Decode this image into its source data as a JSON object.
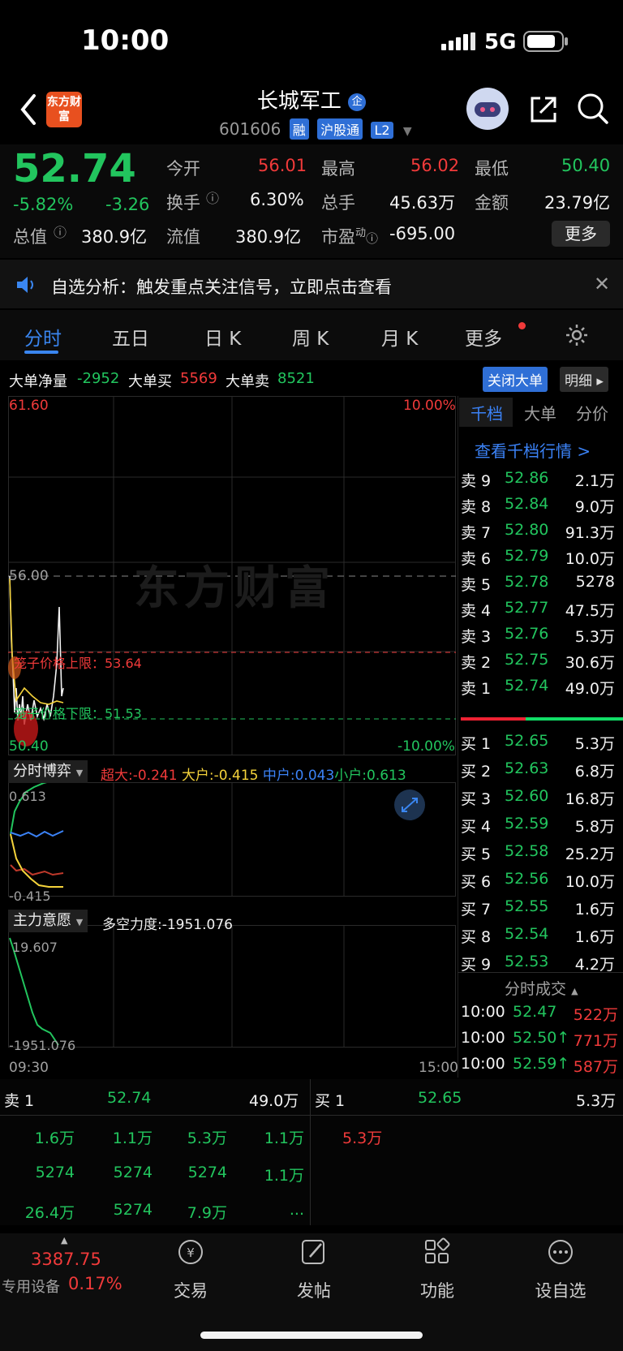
{
  "status": {
    "time": "10:00",
    "network": "5G"
  },
  "header": {
    "back": "‹",
    "logo_text": "东方财富",
    "title": "长城军工",
    "title_badge": "企",
    "code": "601606",
    "tags": [
      "融",
      "沪股通",
      "L2"
    ]
  },
  "quote": {
    "price": "52.74",
    "change_pct": "-5.82%",
    "change": "-3.26",
    "open_label": "今开",
    "open": "56.01",
    "high_label": "最高",
    "high": "56.02",
    "low_label": "最低",
    "low": "50.40",
    "turnover_label": "换手",
    "turnover": "6.30%",
    "volume_label": "总手",
    "volume": "45.63万",
    "amount_label": "金额",
    "amount": "23.79亿",
    "mcap_label": "总值",
    "mcap": "380.9亿",
    "float_label": "流值",
    "float": "380.9亿",
    "pe_label": "市盈",
    "pe_sup": "动",
    "pe": "-695.00",
    "more_label": "更多"
  },
  "notice": {
    "text": "自选分析：触发重点关注信号，立即点击查看"
  },
  "tabs": [
    "分时",
    "五日",
    "日 K",
    "周 K",
    "月 K",
    "更多"
  ],
  "bigorder": {
    "net_label": "大单净量",
    "net": "-2952",
    "buy_label": "大单买",
    "buy": "5569",
    "sell_label": "大单卖",
    "sell": "8521",
    "close_label": "关闭大单",
    "detail_label": "明细"
  },
  "chart": {
    "top_price": "61.60",
    "top_pct": "10.00%",
    "ref_price": "56.00",
    "upper_limit_label": "笼子价格上限：53.64",
    "lower_limit_label": "笼子价格下限：51.53",
    "bottom_price": "50.40",
    "bottom_pct": "-10.00%",
    "watermark": "东方财富",
    "game_label": "分时博弈",
    "super_label": "超大:-0.241",
    "big_label": "大户:-0.415",
    "mid_label": "中户:0.043",
    "small_label": "小户:0.613",
    "game_top": "0.613",
    "game_bottom": "-0.415",
    "will_label": "主力意愿",
    "force_label": "多空力度:-1951.076",
    "will_top": "19.607",
    "will_bottom": "-1951.076",
    "time_start": "09:30",
    "time_end": "15:00"
  },
  "orderbook": {
    "tabs": [
      "千档",
      "大单",
      "分价"
    ],
    "link": "查看千档行情 >",
    "asks": [
      {
        "label": "卖 9",
        "price": "52.86",
        "vol": "2.1万"
      },
      {
        "label": "卖 8",
        "price": "52.84",
        "vol": "9.0万"
      },
      {
        "label": "卖 7",
        "price": "52.80",
        "vol": "91.3万"
      },
      {
        "label": "卖 6",
        "price": "52.79",
        "vol": "10.0万"
      },
      {
        "label": "卖 5",
        "price": "52.78",
        "vol": "5278"
      },
      {
        "label": "卖 4",
        "price": "52.77",
        "vol": "47.5万"
      },
      {
        "label": "卖 3",
        "price": "52.76",
        "vol": "5.3万"
      },
      {
        "label": "卖 2",
        "price": "52.75",
        "vol": "30.6万"
      },
      {
        "label": "卖 1",
        "price": "52.74",
        "vol": "49.0万"
      }
    ],
    "bids": [
      {
        "label": "买 1",
        "price": "52.65",
        "vol": "5.3万"
      },
      {
        "label": "买 2",
        "price": "52.63",
        "vol": "6.8万"
      },
      {
        "label": "买 3",
        "price": "52.60",
        "vol": "16.8万"
      },
      {
        "label": "买 4",
        "price": "52.59",
        "vol": "5.8万"
      },
      {
        "label": "买 5",
        "price": "52.58",
        "vol": "25.2万"
      },
      {
        "label": "买 6",
        "price": "52.56",
        "vol": "10.0万"
      },
      {
        "label": "买 7",
        "price": "52.55",
        "vol": "1.6万"
      },
      {
        "label": "买 8",
        "price": "52.54",
        "vol": "1.6万"
      },
      {
        "label": "买 9",
        "price": "52.53",
        "vol": "4.2万"
      }
    ],
    "ticks_title": "分时成交",
    "ticks": [
      {
        "time": "10:00",
        "price": "52.47",
        "vol": "522万"
      },
      {
        "time": "10:00",
        "price": "52.50↑",
        "vol": "771万"
      },
      {
        "time": "10:00",
        "price": "52.59↑",
        "vol": "587万"
      }
    ]
  },
  "bottom": {
    "sell1_label": "卖 1",
    "sell1_price": "52.74",
    "sell1_vol": "49.0万",
    "buy1_label": "买 1",
    "buy1_price": "52.65",
    "buy1_vol": "5.3万",
    "sell_grid": [
      [
        "1.6万",
        "1.1万",
        "5.3万",
        "1.1万"
      ],
      [
        "5274",
        "5274",
        "5274",
        "1.1万"
      ],
      [
        "26.4万",
        "5274",
        "7.9万",
        "..."
      ]
    ],
    "buy_grid": [
      "5.3万"
    ]
  },
  "nav": {
    "index_value": "3387.75",
    "index_label": "专用设备",
    "index_change": "0.17%",
    "items": [
      "交易",
      "发帖",
      "功能",
      "设自选"
    ]
  },
  "colors": {
    "up": "#f03a3a",
    "down": "#22c55e",
    "accent": "#3a86f0"
  }
}
